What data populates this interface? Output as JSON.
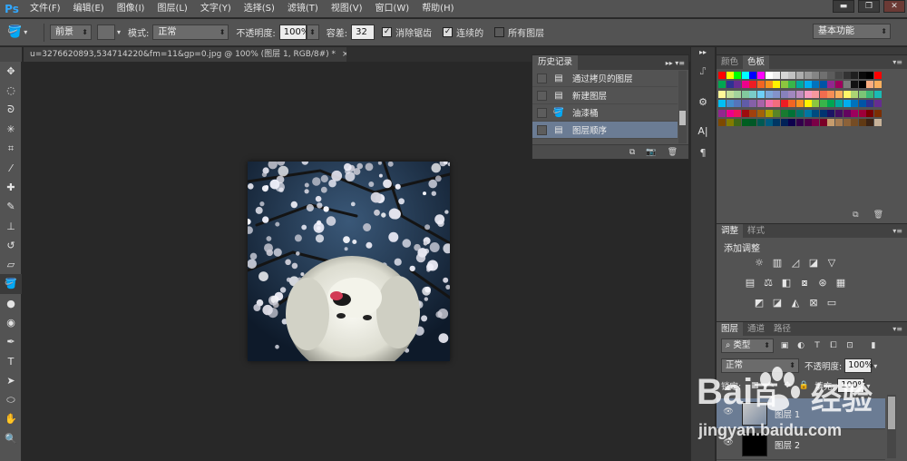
{
  "app": {
    "logo": "Ps"
  },
  "menu": [
    "文件(F)",
    "编辑(E)",
    "图像(I)",
    "图层(L)",
    "文字(Y)",
    "选择(S)",
    "滤镜(T)",
    "视图(V)",
    "窗口(W)",
    "帮助(H)"
  ],
  "window_controls": {
    "minimize": "▬",
    "restore": "❐",
    "close": "✕"
  },
  "options": {
    "fill_source": "前景",
    "mode_label": "模式:",
    "mode_value": "正常",
    "opacity_label": "不透明度:",
    "opacity_value": "100%",
    "tolerance_label": "容差:",
    "tolerance_value": "32",
    "antialias_label": "消除锯齿",
    "antialias_checked": true,
    "contiguous_label": "连续的",
    "contiguous_checked": true,
    "all_layers_label": "所有图层",
    "all_layers_checked": false,
    "workspace": "基本功能"
  },
  "document_tab": {
    "title": "u=3276620893,534714220&fm=11&gp=0.jpg @ 100% (图层 1, RGB/8#) *",
    "close": "×"
  },
  "history": {
    "tab": "历史记录",
    "items": [
      {
        "label": "通过拷贝的图层",
        "icon": "document-icon"
      },
      {
        "label": "新建图层",
        "icon": "document-icon"
      },
      {
        "label": "油漆桶",
        "icon": "paint-bucket-icon"
      },
      {
        "label": "图层顺序",
        "icon": "document-icon",
        "active": true
      }
    ]
  },
  "swatches_panel": {
    "tabs": [
      "颜色",
      "色板"
    ],
    "active_tab": "色板"
  },
  "adjust_panel": {
    "tabs": [
      "调整",
      "样式"
    ],
    "active_tab": "调整",
    "title": "添加调整"
  },
  "layers_panel": {
    "tabs": [
      "图层",
      "通道",
      "路径"
    ],
    "active_tab": "图层",
    "filter_kind": "类型",
    "blend_mode": "正常",
    "opacity_label": "不透明度:",
    "opacity_value": "100%",
    "lock_label": "锁定:",
    "fill_label": "填充:",
    "fill_value": "100%",
    "layers": [
      {
        "name": "图层 1",
        "active": true
      },
      {
        "name": "图层 2",
        "active": false
      }
    ]
  },
  "watermark": {
    "brand": "Bai",
    "brand_tail": "百",
    "cn": "经验",
    "url": "jingyan.baidu.com"
  },
  "colors": {
    "ui_bg": "#535353",
    "canvas_bg": "#282828",
    "selection": "#6b7c94",
    "ps_blue": "#31a8ff"
  }
}
